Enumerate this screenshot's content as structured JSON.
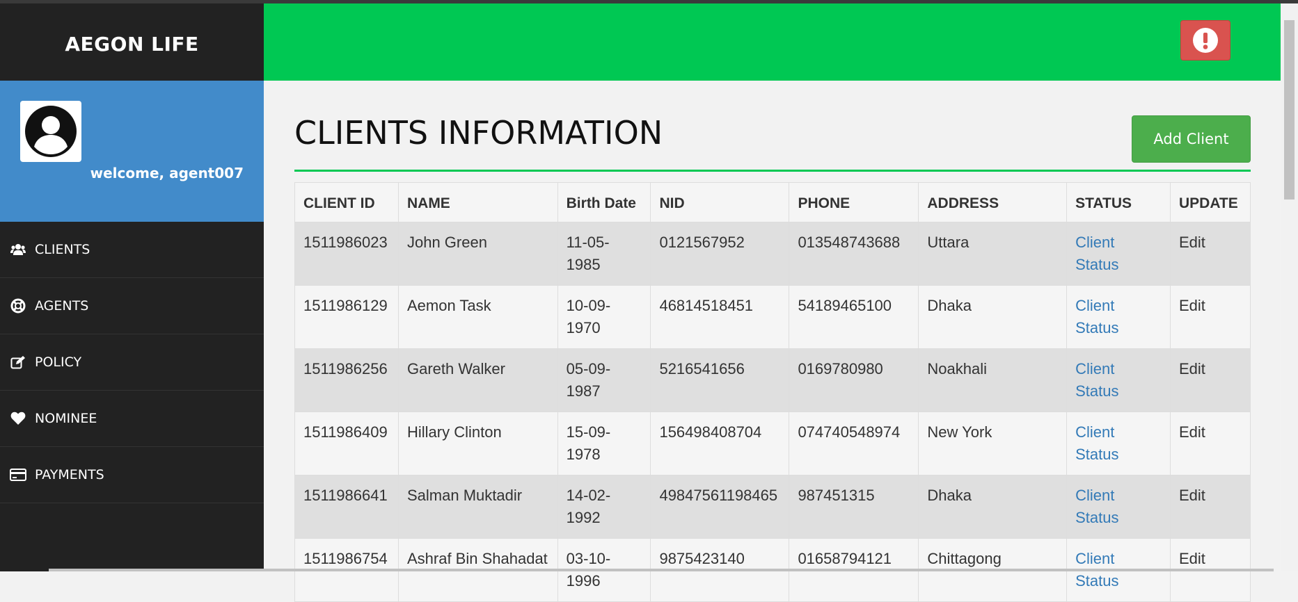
{
  "app": {
    "brand": "AEGON LIFE"
  },
  "profile": {
    "welcome": "welcome, agent007"
  },
  "sidebar": {
    "items": [
      {
        "label": "CLIENTS",
        "icon": "users-icon"
      },
      {
        "label": "AGENTS",
        "icon": "life-ring-icon"
      },
      {
        "label": "POLICY",
        "icon": "edit-icon"
      },
      {
        "label": "NOMINEE",
        "icon": "heart-icon"
      },
      {
        "label": "PAYMENTS",
        "icon": "credit-card-icon"
      }
    ]
  },
  "topbar": {
    "alert_icon": "exclamation-circle-icon",
    "alert_color": "#d9534f",
    "bar_color": "#00c853"
  },
  "main": {
    "title": "CLIENTS INFORMATION",
    "add_button": "Add Client",
    "table": {
      "headers": [
        "CLIENT ID",
        "NAME",
        "Birth Date",
        "NID",
        "PHONE",
        "ADDRESS",
        "STATUS",
        "UPDATE"
      ],
      "rows": [
        {
          "id": "1511986023",
          "name": "John Green",
          "birth": "11-05-1985",
          "nid": "0121567952",
          "phone": "013548743688",
          "address": "Uttara",
          "status": "Client Status",
          "update": "Edit"
        },
        {
          "id": "1511986129",
          "name": "Aemon Task",
          "birth": "10-09-1970",
          "nid": "46814518451",
          "phone": "54189465100",
          "address": "Dhaka",
          "status": "Client Status",
          "update": "Edit"
        },
        {
          "id": "1511986256",
          "name": "Gareth Walker",
          "birth": "05-09-1987",
          "nid": "5216541656",
          "phone": "0169780980",
          "address": "Noakhali",
          "status": "Client Status",
          "update": "Edit"
        },
        {
          "id": "1511986409",
          "name": "Hillary Clinton",
          "birth": "15-09-1978",
          "nid": "156498408704",
          "phone": "074740548974",
          "address": "New York",
          "status": "Client Status",
          "update": "Edit"
        },
        {
          "id": "1511986641",
          "name": "Salman Muktadir",
          "birth": "14-02-1992",
          "nid": "49847561198465",
          "phone": "987451315",
          "address": "Dhaka",
          "status": "Client Status",
          "update": "Edit"
        },
        {
          "id": "1511986754",
          "name": "Ashraf Bin Shahadat",
          "birth": "03-10-1996",
          "nid": "9875423140",
          "phone": "01658794121",
          "address": "Chittagong",
          "status": "Client Status",
          "update": "Edit"
        }
      ]
    }
  }
}
